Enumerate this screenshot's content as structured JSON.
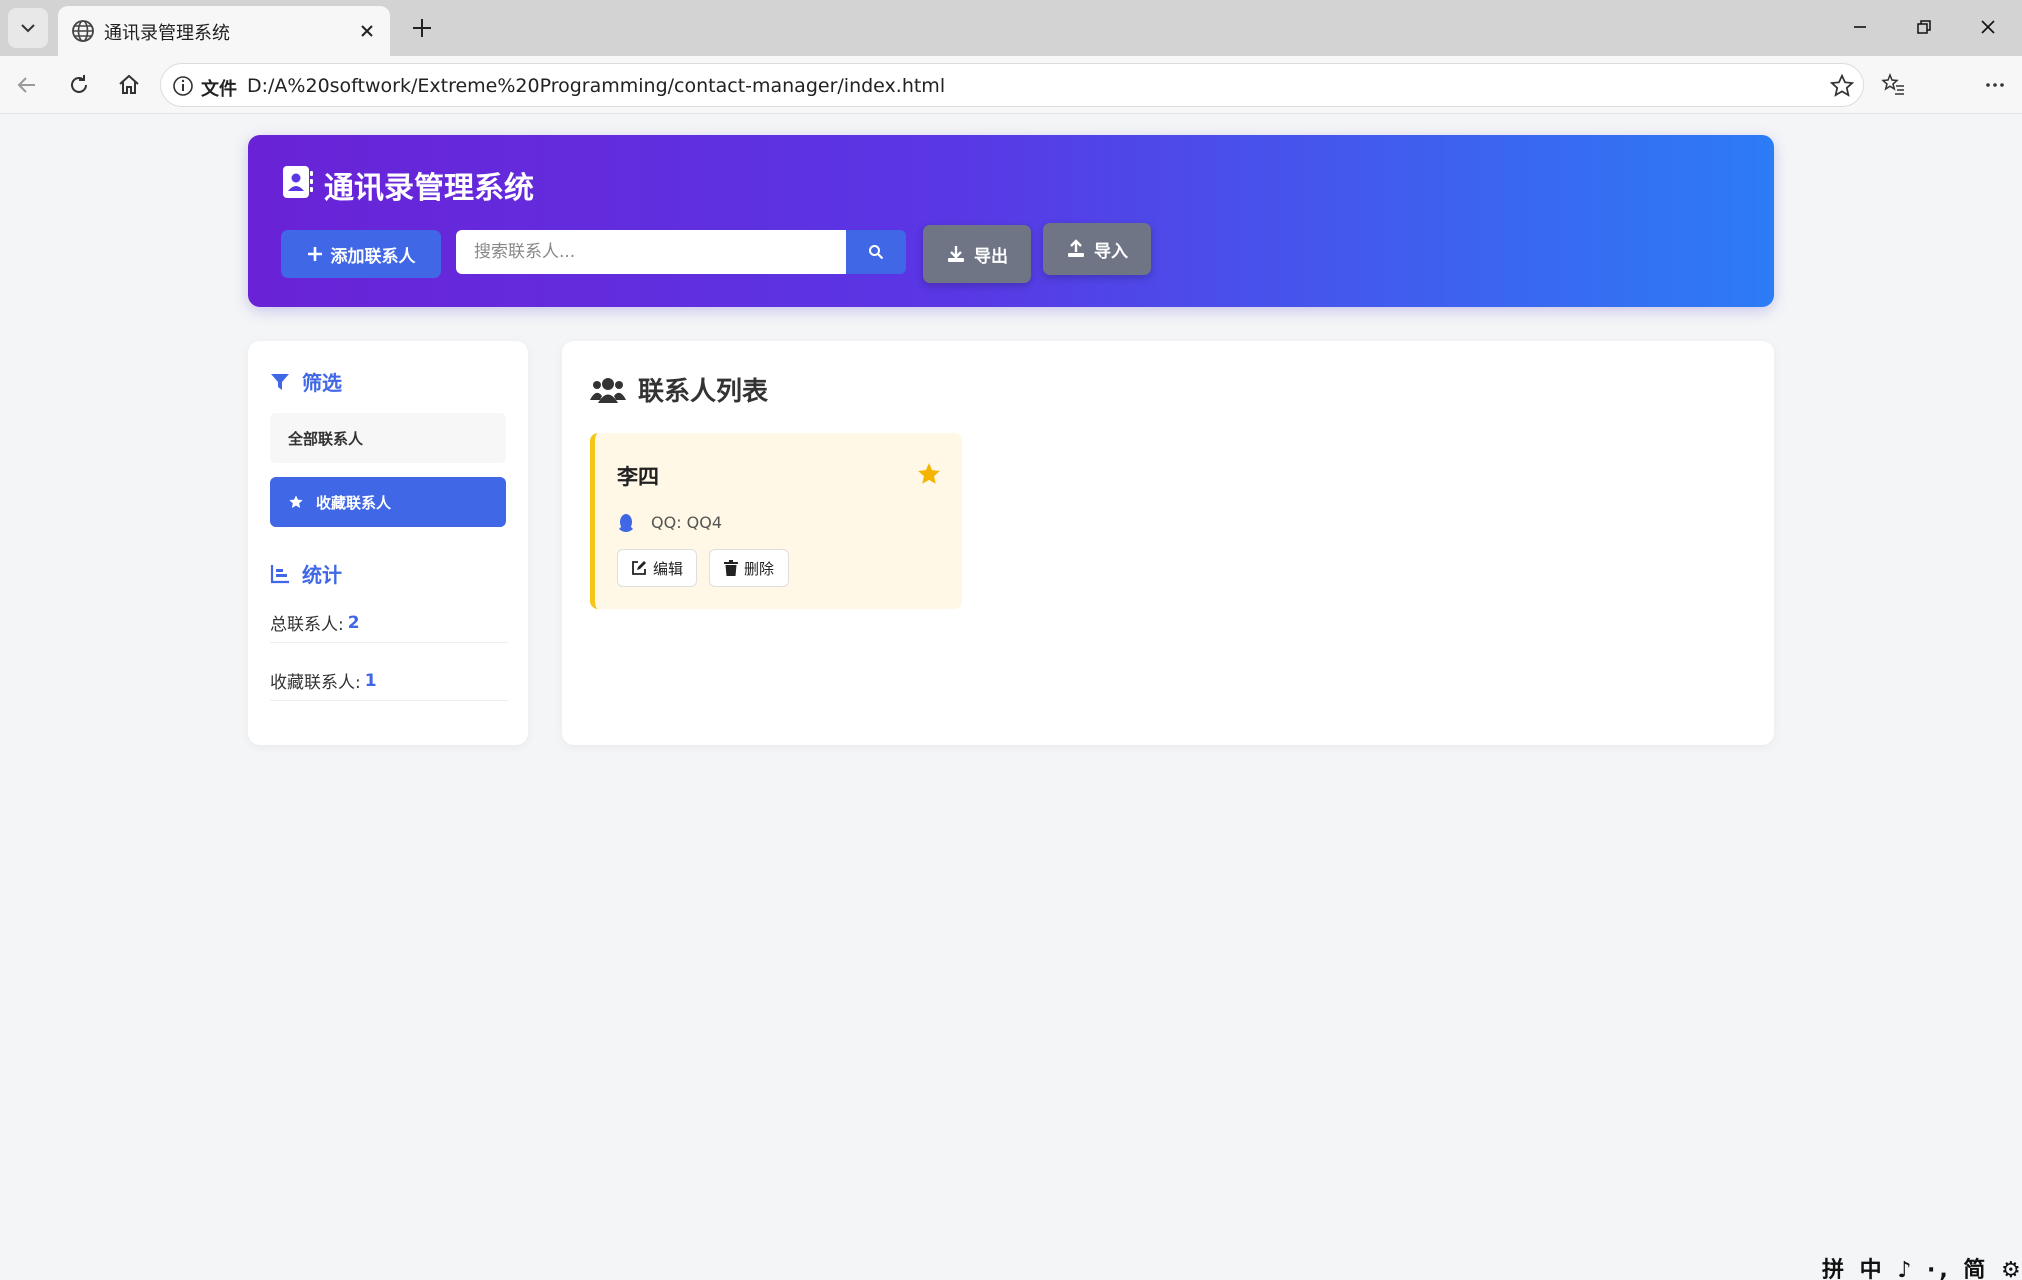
{
  "browser": {
    "tab_title": "通讯录管理系统",
    "address_label": "文件",
    "address_url": "D:/A%20softwork/Extreme%20Programming/contact-manager/index.html"
  },
  "header": {
    "title": "通讯录管理系统",
    "add_button": "添加联系人",
    "search_placeholder": "搜索联系人...",
    "export_button": "导出",
    "import_button": "导入"
  },
  "sidebar": {
    "filter_title": "筛选",
    "filters": [
      {
        "label": "全部联系人",
        "active": false
      },
      {
        "label": "收藏联系人",
        "active": true
      }
    ],
    "stats_title": "统计",
    "stats": [
      {
        "label": "总联系人: ",
        "value": "2"
      },
      {
        "label": "收藏联系人: ",
        "value": "1"
      }
    ]
  },
  "main": {
    "title": "联系人列表",
    "contacts": [
      {
        "name": "李四",
        "favorite": true,
        "qq": "QQ: QQ4",
        "edit_label": "编辑",
        "delete_label": "删除"
      }
    ]
  },
  "ime": {
    "text": "拼 中 ♪ ·, 简 ⚙"
  },
  "colors": {
    "accent": "#3f67e6",
    "header_gradient_start": "#6a22d6",
    "header_gradient_end": "#2c7cf6",
    "favorite": "#f5b400",
    "card_bg": "#fff8e6"
  }
}
